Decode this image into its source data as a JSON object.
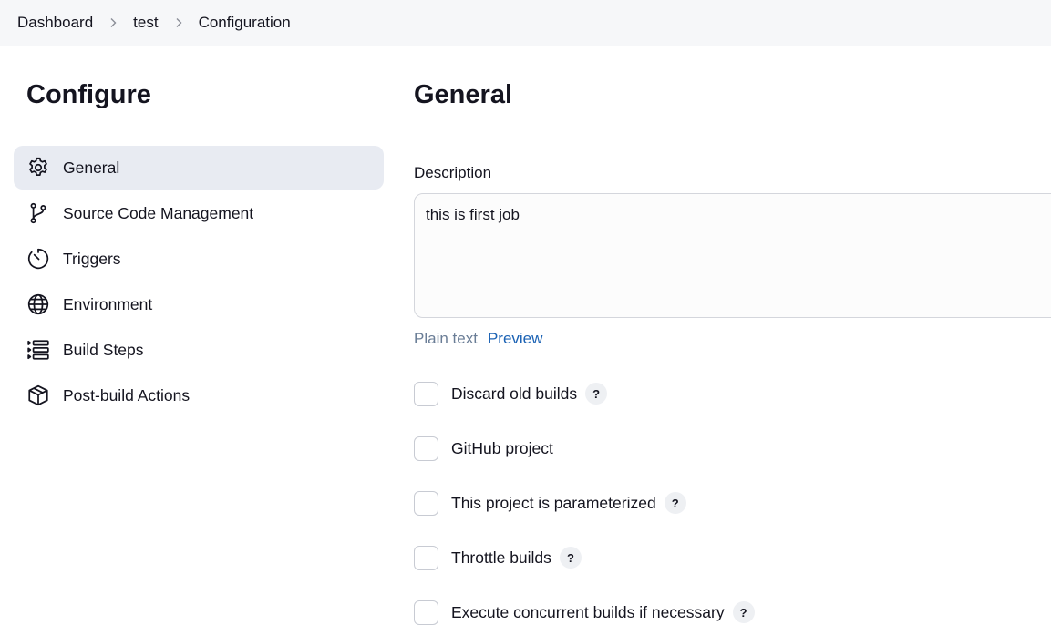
{
  "breadcrumb": {
    "items": [
      "Dashboard",
      "test",
      "Configuration"
    ]
  },
  "sidebar": {
    "title": "Configure",
    "items": [
      {
        "label": "General",
        "icon": "gear-icon",
        "active": true
      },
      {
        "label": "Source Code Management",
        "icon": "git-branch-icon",
        "active": false
      },
      {
        "label": "Triggers",
        "icon": "timer-icon",
        "active": false
      },
      {
        "label": "Environment",
        "icon": "globe-icon",
        "active": false
      },
      {
        "label": "Build Steps",
        "icon": "list-steps-icon",
        "active": false
      },
      {
        "label": "Post-build Actions",
        "icon": "package-icon",
        "active": false
      }
    ]
  },
  "main": {
    "title": "General",
    "description": {
      "label": "Description",
      "value": "this is first job",
      "plain_text": "Plain text",
      "preview": "Preview"
    },
    "options": [
      {
        "label": "Discard old builds",
        "help": "?",
        "checked": false
      },
      {
        "label": "GitHub project",
        "help": null,
        "checked": false
      },
      {
        "label": "This project is parameterized",
        "help": "?",
        "checked": false
      },
      {
        "label": "Throttle builds",
        "help": "?",
        "checked": false
      },
      {
        "label": "Execute concurrent builds if necessary",
        "help": "?",
        "checked": false
      }
    ]
  },
  "colors": {
    "active_bg": "#e8ebf2",
    "link": "#1b62b4",
    "muted": "#6a7d96"
  }
}
